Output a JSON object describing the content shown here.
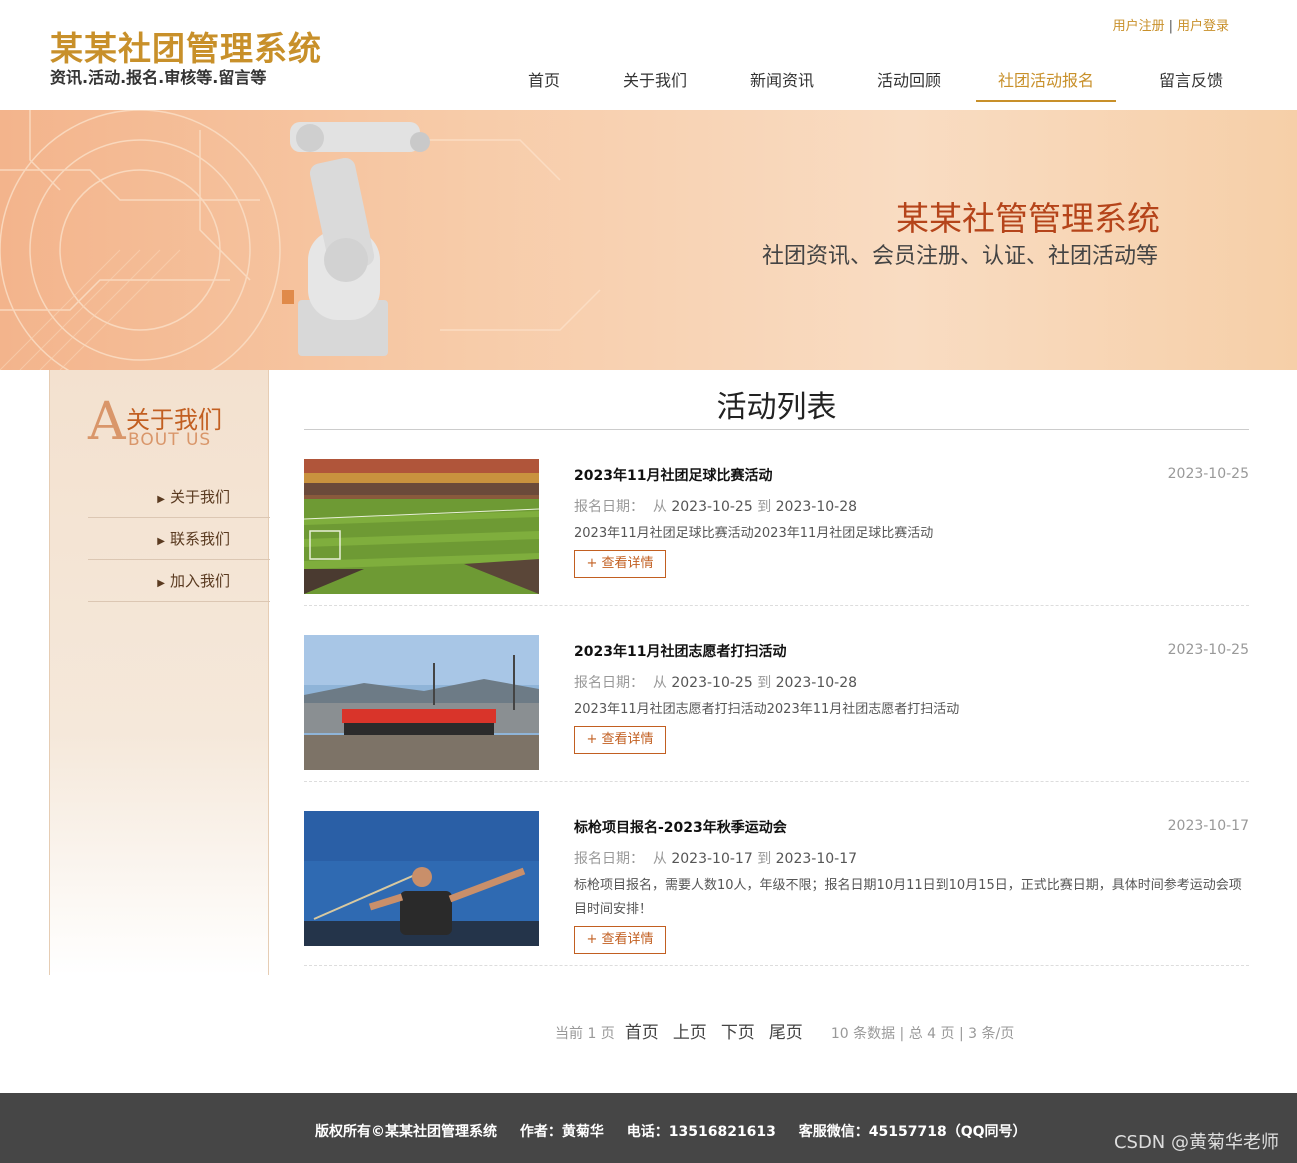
{
  "header": {
    "site_title": "某某社团管理系统",
    "site_subtitle": "资讯.活动.报名.审核等.留言等",
    "register": "用户注册",
    "separator": "|",
    "login": "用户登录",
    "nav": [
      {
        "label": "首页"
      },
      {
        "label": "关于我们"
      },
      {
        "label": "新闻资讯"
      },
      {
        "label": "活动回顾"
      },
      {
        "label": "社团活动报名"
      },
      {
        "label": "留言反馈"
      }
    ],
    "active_nav": "社团活动报名"
  },
  "banner": {
    "title": "某某社管管理系统",
    "subtitle": "社团资讯、会员注册、认证、社团活动等"
  },
  "sidebar": {
    "big_letter": "A",
    "heading_cn": "关于我们",
    "heading_en": "BOUT US",
    "items": [
      {
        "label": "关于我们"
      },
      {
        "label": "联系我们"
      },
      {
        "label": "加入我们"
      }
    ]
  },
  "main": {
    "title": "活动列表",
    "period_label": "报名日期：",
    "from": "从",
    "to": "到",
    "detail_button": "+ 查看详情",
    "activities": [
      {
        "title": "2023年11月社团足球比赛活动",
        "date": "2023-10-25",
        "start": "2023-10-25",
        "end": "2023-10-28",
        "desc": "2023年11月社团足球比赛活动2023年11月社团足球比赛活动"
      },
      {
        "title": "2023年11月社团志愿者打扫活动",
        "date": "2023-10-25",
        "start": "2023-10-25",
        "end": "2023-10-28",
        "desc": "2023年11月社团志愿者打扫活动2023年11月社团志愿者打扫活动"
      },
      {
        "title": "标枪项目报名-2023年秋季运动会",
        "date": "2023-10-17",
        "start": "2023-10-17",
        "end": "2023-10-17",
        "desc": "标枪项目报名，需要人数10人，年级不限；报名日期10月11日到10月15日，正式比赛日期，具体时间参考运动会项目时间安排！"
      }
    ]
  },
  "pager": {
    "current": "当前 1 页",
    "first": "首页",
    "prev": "上页",
    "next": "下页",
    "last": "尾页",
    "info": "10 条数据 | 总 4 页 | 3 条/页"
  },
  "footer": {
    "copyright": "版权所有©某某社团管理系统",
    "author": "作者：黄菊华",
    "phone": "电话：13516821613",
    "wechat": "客服微信：45157718（QQ同号）"
  },
  "watermark": "CSDN @黄菊华老师",
  "colors": {
    "accent": "#c8902a",
    "brand_dark": "#c25f21",
    "footer_bg": "#464646"
  }
}
